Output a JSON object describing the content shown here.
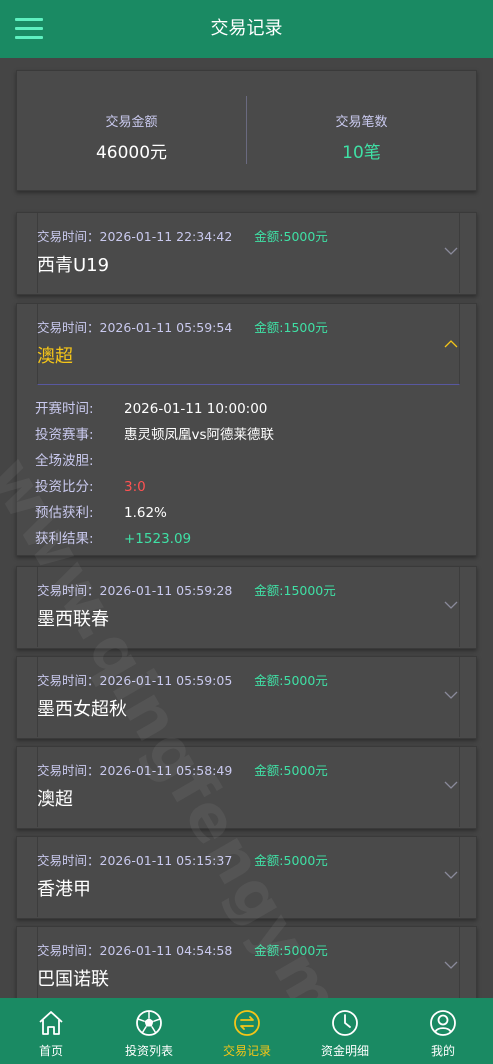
{
  "header": {
    "title": "交易记录",
    "menu_icon": "menu-icon"
  },
  "summary": {
    "amount_label": "交易金额",
    "amount_value": "46000元",
    "count_label": "交易笔数",
    "count_value": "10笔"
  },
  "watermark": "www.qingfengymw.清风源码",
  "records": [
    {
      "time_label": "交易时间：",
      "time": "2026-01-11 22:34:42",
      "amount": "金额:5000元",
      "league": "西青U19",
      "expanded": false
    },
    {
      "time_label": "交易时间：",
      "time": "2026-01-11 05:59:54",
      "amount": "金额:1500元",
      "league": "澳超",
      "expanded": true,
      "details": [
        {
          "label": "开赛时间:",
          "value": "2026-01-11 10:00:00",
          "tone": "white"
        },
        {
          "label": "投资赛事:",
          "value": "惠灵顿凤凰vs阿德莱德联",
          "tone": "white"
        },
        {
          "label": "全场波胆:",
          "value": "",
          "tone": "white"
        },
        {
          "label": "投资比分:",
          "value": "3:0",
          "tone": "red"
        },
        {
          "label": "预估获利:",
          "value": "1.62%",
          "tone": "white"
        },
        {
          "label": "获利结果:",
          "value": "+1523.09",
          "tone": "green"
        }
      ]
    },
    {
      "time_label": "交易时间：",
      "time": "2026-01-11 05:59:28",
      "amount": "金额:15000元",
      "league": "墨西联春",
      "expanded": false
    },
    {
      "time_label": "交易时间：",
      "time": "2026-01-11 05:59:05",
      "amount": "金额:5000元",
      "league": "墨西女超秋",
      "expanded": false
    },
    {
      "time_label": "交易时间：",
      "time": "2026-01-11 05:58:49",
      "amount": "金额:5000元",
      "league": "澳超",
      "expanded": false
    },
    {
      "time_label": "交易时间：",
      "time": "2026-01-11 05:15:37",
      "amount": "金额:5000元",
      "league": "香港甲",
      "expanded": false
    },
    {
      "time_label": "交易时间：",
      "time": "2026-01-11 04:54:58",
      "amount": "金额:5000元",
      "league": "巴国诺联",
      "expanded": false
    }
  ],
  "tabs": [
    {
      "label": "首页",
      "icon": "home-icon",
      "active": false
    },
    {
      "label": "投资列表",
      "icon": "football-icon",
      "active": false
    },
    {
      "label": "交易记录",
      "icon": "exchange-icon",
      "active": true
    },
    {
      "label": "资金明细",
      "icon": "clock-icon",
      "active": false
    },
    {
      "label": "我的",
      "icon": "user-icon",
      "active": false
    }
  ],
  "colors": {
    "header_bg": "#1a8a63",
    "page_bg": "#454545",
    "card_bg": "#4a4a4a",
    "accent_green": "#3fe0a5",
    "accent_yellow": "#f5c518",
    "label_lavender": "#c9c9ee",
    "score_red": "#ff5252"
  }
}
